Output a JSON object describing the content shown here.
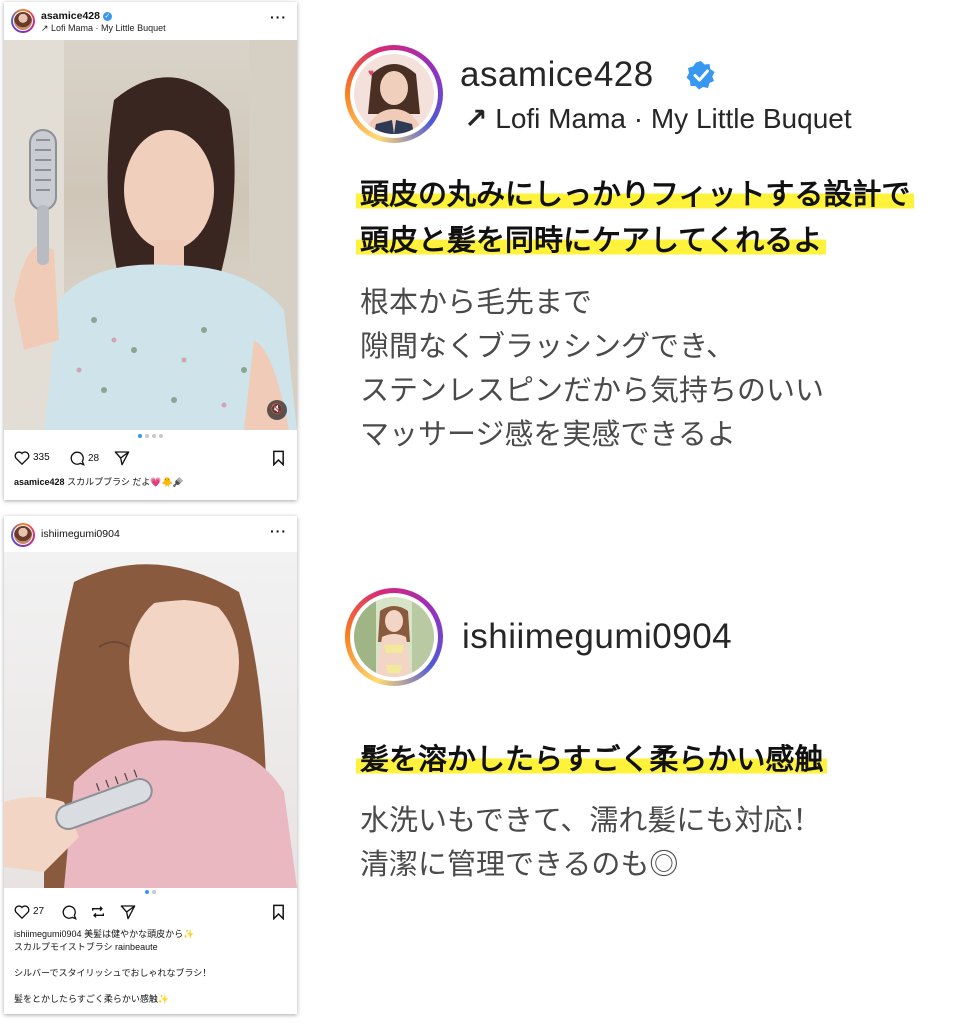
{
  "post1": {
    "username": "asamice428",
    "music": "↗ Lofi Mama · My Little Buquet",
    "likes": "335",
    "comments": "28",
    "caption_user": "asamice428",
    "caption_text": "スカルプブラシ だよ💗🐥🪮"
  },
  "post2": {
    "username": "ishiimegumi0904",
    "likes": "27",
    "caption_user": "ishiimegumi0904",
    "caption_line1": "美髪は健やかな頭皮から✨",
    "caption_line2": "スカルプモイストブラシ rainbeaute",
    "caption_line3": "シルバーでスタイリッシュでおしゃれなブラシ！",
    "caption_line4": "髪をとかしたらすごく柔らかい感触✨"
  },
  "feature1": {
    "username": "asamice428",
    "music_arrow": "↗",
    "music": "Lofi Mama · My Little Buquet",
    "headline_line1": "頭皮の丸みにしっかりフィットする設計で",
    "headline_line2": "頭皮と髪を同時にケアしてくれるよ",
    "body": [
      "根本から毛先まで",
      "隙間なくブラッシングでき、",
      "ステンレスピンだから気持ちのいい",
      "マッサージ感を実感できるよ"
    ]
  },
  "feature2": {
    "username": "ishiimegumi0904",
    "headline": "髪を溶かしたらすごく柔らかい感触",
    "body": [
      "水洗いもできて、濡れ髪にも対応！",
      "清潔に管理できるのも◎"
    ]
  },
  "icons": {
    "verified_color": "#3897f0",
    "highlight_color": "#fff23a"
  }
}
